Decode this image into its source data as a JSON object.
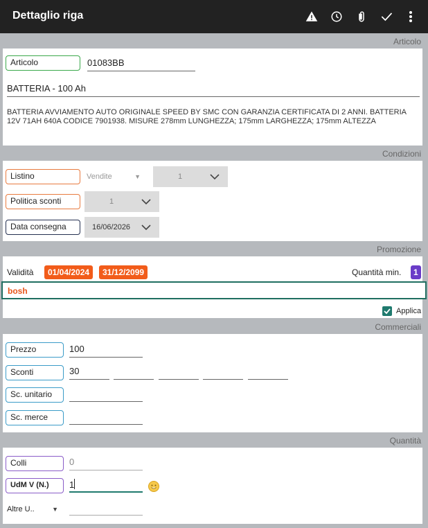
{
  "header": {
    "title": "Dettaglio riga",
    "icons": [
      "warning-icon",
      "clock-icon",
      "paperclip-icon",
      "check-icon",
      "more-vert-icon"
    ]
  },
  "articolo": {
    "section_label": "Articolo",
    "code_label": "Articolo",
    "code_value": "01083BB",
    "name": "BATTERIA - 100 Ah",
    "description": "BATTERIA AVVIAMENTO AUTO ORIGINALE SPEED BY SMC CON GARANZIA CERTIFICATA DI 2 ANNI. BATTERIA 12V 71AH 640A CODICE 7901938. MISURE 278mm LUNGHEZZA; 175mm LARGHEZZA; 175mm ALTEZZA"
  },
  "condizioni": {
    "section_label": "Condizioni",
    "listino_label": "Listino",
    "listino_type": "Vendite",
    "listino_value": "1",
    "politica_label": "Politica sconti",
    "politica_value": "1",
    "consegna_label": "Data consegna",
    "consegna_value": "16/06/2026"
  },
  "promozione": {
    "section_label": "Promozione",
    "validita_label": "Validità",
    "date_from": "01/04/2024",
    "date_to": "31/12/2099",
    "qty_min_label": "Quantità min.",
    "qty_min_value": "1",
    "promo_name": "bosh",
    "applica_label": "Applica",
    "applica_checked": true,
    "colors": {
      "date_badge": "#f25c1a",
      "qty_badge": "#6a3cc8",
      "promo_border": "#1f6e60",
      "promo_text": "#e8561a"
    }
  },
  "commerciali": {
    "section_label": "Commerciali",
    "prezzo_label": "Prezzo",
    "prezzo_value": "100",
    "sconti_label": "Sconti",
    "sconti_values": [
      "30",
      "",
      "",
      "",
      ""
    ],
    "sc_unitario_label": "Sc. unitario",
    "sc_unitario_value": "",
    "sc_merce_label": "Sc. merce",
    "sc_merce_value": ""
  },
  "quantita": {
    "section_label": "Quantità",
    "colli_label": "Colli",
    "colli_value": "0",
    "udm_label": "UdM V (N.)",
    "udm_value": "1",
    "altre_label": "Altre U..",
    "altre_value": ""
  }
}
